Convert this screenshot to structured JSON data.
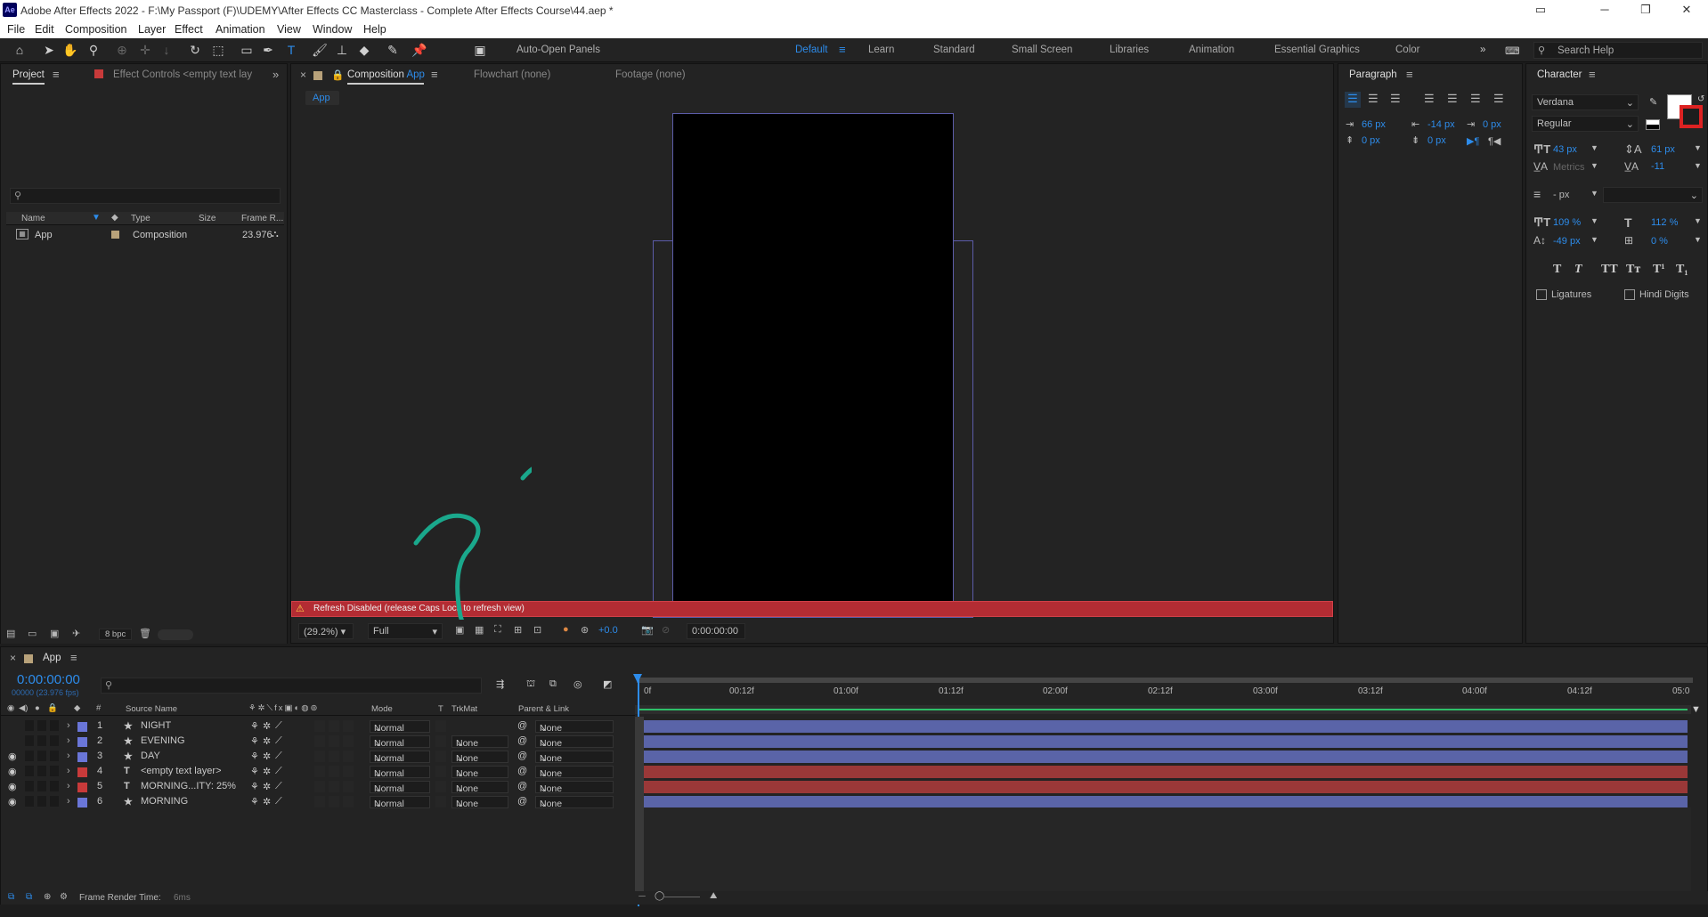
{
  "window": {
    "title": "Adobe After Effects 2022 - F:\\My Passport (F)\\UDEMY\\After Effects CC Masterclass - Complete After Effects Course\\44.aep *",
    "app_icon": "Ae"
  },
  "menu": [
    "File",
    "Edit",
    "Composition",
    "Layer",
    "Effect",
    "Animation",
    "View",
    "Window",
    "Help"
  ],
  "toolbar": {
    "auto_open_label": "Auto-Open Panels",
    "workspaces": [
      "Default",
      "Learn",
      "Standard",
      "Small Screen",
      "Libraries",
      "Animation",
      "Essential Graphics",
      "Color"
    ],
    "active_workspace": "Default",
    "search_placeholder": "Search Help"
  },
  "project_panel": {
    "tab_project": "Project",
    "tab_effects": "Effect Controls <empty text lay",
    "columns": [
      "Name",
      "Type",
      "Size",
      "Frame R..."
    ],
    "items": [
      {
        "name": "App",
        "type": "Composition",
        "frame_rate": "23.976"
      }
    ],
    "bpc": "8 bpc"
  },
  "comp_panel": {
    "tab_label": "Composition",
    "tab_comp_name": "App",
    "flowchart": "Flowchart (none)",
    "footage": "Footage (none)",
    "breadcrumb": "App",
    "warning": "Refresh Disabled (release Caps Lock to refresh view)",
    "zoom": "(29.2%)",
    "resolution": "Full",
    "timecode": "0:00:00:00",
    "exposure": "+0.0"
  },
  "paragraph_panel": {
    "title": "Paragraph",
    "indent_left": "66 px",
    "indent_right": "-14 px",
    "indent_first": "0 px",
    "space_before": "0 px",
    "space_after": "0 px",
    "space_after2": "0 px"
  },
  "character_panel": {
    "title": "Character",
    "font": "Verdana",
    "style": "Regular",
    "font_size": "43 px",
    "leading": "61 px",
    "kerning": "Metrics",
    "tracking": "-11",
    "stroke": "- px",
    "vert_scale": "109 %",
    "horiz_scale": "112 %",
    "baseline": "-49 px",
    "tsume": "0 %",
    "ligatures": "Ligatures",
    "hindi_digits": "Hindi Digits",
    "fill_color": "#ffffff"
  },
  "timeline": {
    "comp_tab": "App",
    "timecode": "0:00:00:00",
    "frames": "00000 (23.976 fps)",
    "columns": {
      "source": "Source Name",
      "mode": "Mode",
      "t": "T",
      "trkmat": "TrkMat",
      "parent": "Parent & Link"
    },
    "ruler": [
      "0f",
      "00:12f",
      "01:00f",
      "01:12f",
      "02:00f",
      "02:12f",
      "03:00f",
      "03:12f",
      "04:00f",
      "04:12f",
      "05:0"
    ],
    "layers": [
      {
        "num": "1",
        "type": "star",
        "name": "NIGHT",
        "mode": "Normal",
        "trkmat": "",
        "parent": "None",
        "color": "#6a76d8",
        "bar": "#5a64a8",
        "visible": false
      },
      {
        "num": "2",
        "type": "star",
        "name": "EVENING",
        "mode": "Normal",
        "trkmat": "None",
        "parent": "None",
        "color": "#6a76d8",
        "bar": "#5a64a8",
        "visible": false
      },
      {
        "num": "3",
        "type": "star",
        "name": "DAY",
        "mode": "Normal",
        "trkmat": "None",
        "parent": "None",
        "color": "#6a76d8",
        "bar": "#5a64a8",
        "visible": true
      },
      {
        "num": "4",
        "type": "T",
        "name": "<empty text layer>",
        "mode": "Normal",
        "trkmat": "None",
        "parent": "None",
        "color": "#c83a3a",
        "bar": "#9a3838",
        "visible": true
      },
      {
        "num": "5",
        "type": "T",
        "name": "MORNING...ITY: 25%",
        "mode": "Normal",
        "trkmat": "None",
        "parent": "None",
        "color": "#c83a3a",
        "bar": "#9a3838",
        "visible": true
      },
      {
        "num": "6",
        "type": "star",
        "name": "MORNING",
        "mode": "Normal",
        "trkmat": "None",
        "parent": "None",
        "color": "#6a76d8",
        "bar": "#5a64a8",
        "visible": true
      }
    ],
    "render_time_label": "Frame Render Time:",
    "render_time_value": "6ms"
  }
}
